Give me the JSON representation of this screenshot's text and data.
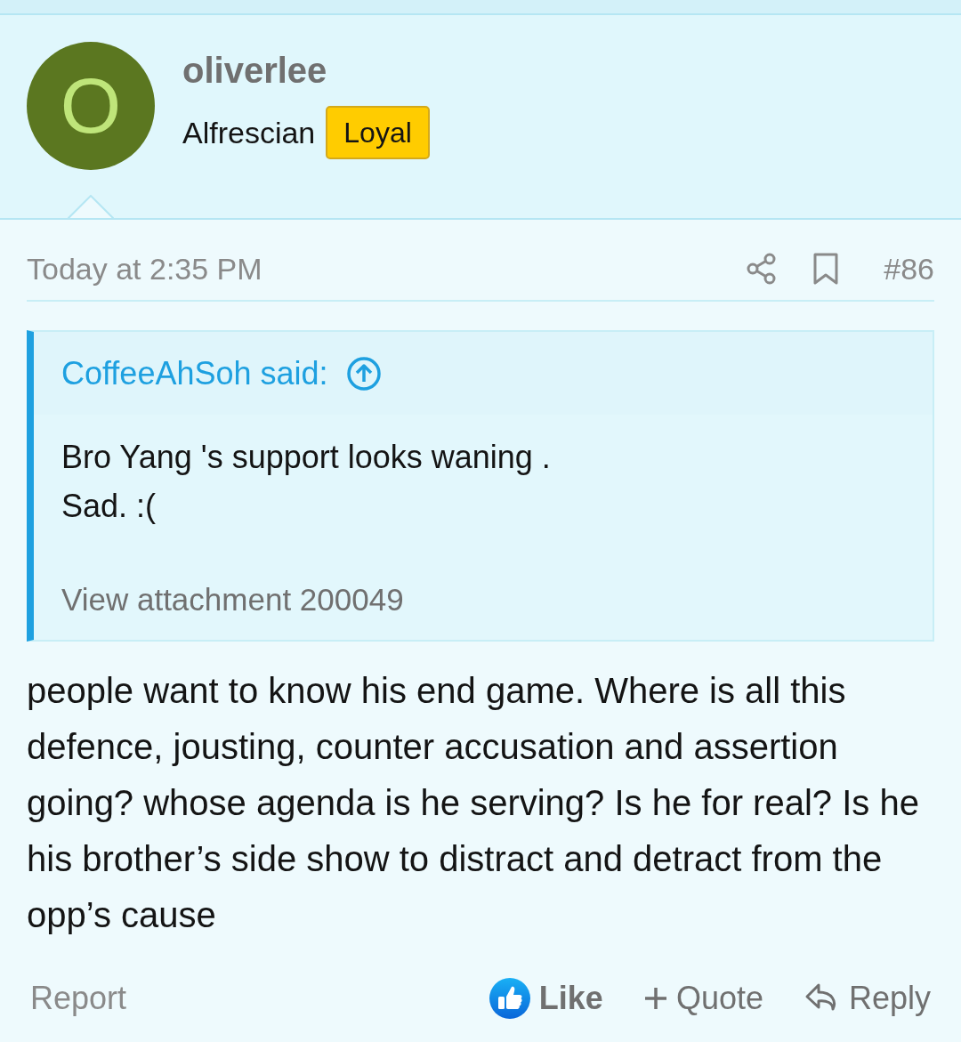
{
  "author": {
    "initial": "O",
    "name": "oliverlee",
    "title": "Alfrescian",
    "badge": "Loyal"
  },
  "post": {
    "time": "Today at 2:35 PM",
    "number": "#86"
  },
  "quote": {
    "header": "CoffeeAhSoh said:",
    "lines": [
      "Bro Yang 's support looks waning .",
      "Sad. :("
    ],
    "attachment": "View attachment 200049"
  },
  "message": "people want to know his end game. Where is all this defence, jousting, counter accusation and assertion going? whose agenda is he serving? Is he for real? Is he his brother’s side show to distract and detract from the opp’s cause",
  "footer": {
    "report": "Report",
    "actions": [
      {
        "kind": "like",
        "label": "Like"
      },
      {
        "kind": "quote",
        "label": "Quote"
      },
      {
        "kind": "reply",
        "label": "Reply"
      }
    ]
  }
}
